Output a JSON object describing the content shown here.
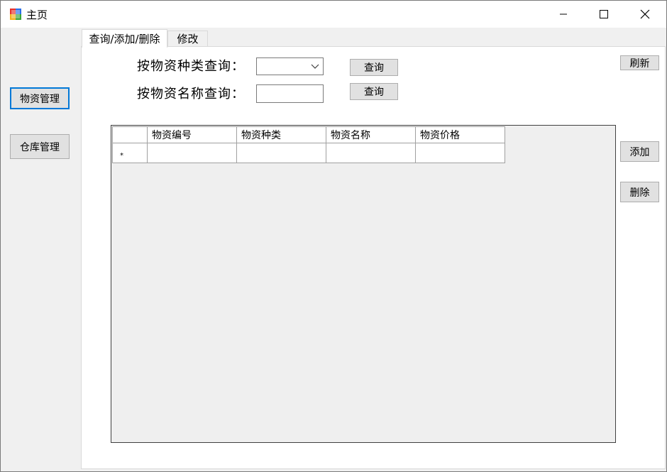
{
  "window": {
    "title": "主页",
    "controls": {
      "minimize": "minimize",
      "maximize": "maximize",
      "close": "close"
    }
  },
  "sidebar": {
    "items": [
      {
        "label": "物资管理",
        "focused": true
      },
      {
        "label": "仓库管理",
        "focused": false
      }
    ]
  },
  "tabs": [
    {
      "label": "查询/添加/删除",
      "active": true
    },
    {
      "label": "修改",
      "active": false
    }
  ],
  "query": {
    "by_type_label": "按物资种类查询：",
    "by_name_label": "按物资名称查询：",
    "type_combo_value": "",
    "name_input_value": "",
    "search_button_1": "查询",
    "search_button_2": "查询"
  },
  "actions": {
    "refresh": "刷新",
    "add": "添加",
    "delete": "删除"
  },
  "grid": {
    "columns": [
      "物资编号",
      "物资种类",
      "物资名称",
      "物资价格"
    ],
    "new_row_marker": "*",
    "rows": []
  },
  "colors": {
    "accent": "#0078d7",
    "button_face": "#e1e1e1",
    "grid_background": "#efefef"
  }
}
